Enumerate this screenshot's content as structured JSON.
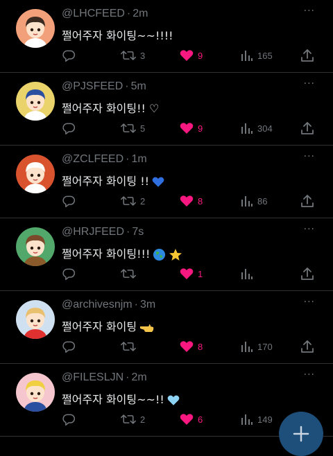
{
  "tweets": [
    {
      "handle": "@LHCFEED",
      "sep": "·",
      "time": "2m",
      "text": "쩔어주자 화이팅~~!!!!",
      "emoji": "",
      "retweets": "3",
      "likes": "9",
      "views": "165"
    },
    {
      "handle": "@PJSFEED",
      "sep": "·",
      "time": "5m",
      "text": "쩔어주자 화이팅!! ♡",
      "emoji": "",
      "retweets": "5",
      "likes": "9",
      "views": "304"
    },
    {
      "handle": "@ZCLFEED",
      "sep": "·",
      "time": "1m",
      "text": "쩔어주자 화이팅 !!",
      "emoji": "blue-heart",
      "retweets": "2",
      "likes": "8",
      "views": "86"
    },
    {
      "handle": "@HRJFEED",
      "sep": "·",
      "time": "7s",
      "text": "쩔어주자 화이팅!!!",
      "emoji": "globe-star",
      "retweets": "",
      "likes": "1",
      "views": ""
    },
    {
      "handle": "@archivesnjm",
      "sep": "·",
      "time": "3m",
      "text": "쩔어주자 화이팅",
      "emoji": "pointing-hand",
      "retweets": "",
      "likes": "8",
      "views": "170"
    },
    {
      "handle": "@FILESLJN",
      "sep": "·",
      "time": "2m",
      "text": "쩔어주자 화이팅~~!!",
      "emoji": "light-blue-heart",
      "retweets": "2",
      "likes": "6",
      "views": "149"
    }
  ],
  "more_label": "···",
  "colors": {
    "background": "#000000",
    "text": "#e7e9ea",
    "muted": "#71767b",
    "like": "#f91880",
    "divider": "#2f3336",
    "fab": "#1d4f7a"
  },
  "avatars": [
    {
      "bg": "#f2a07a",
      "hair": "#3a2a20",
      "shirt": "#ffffff"
    },
    {
      "bg": "#e9d36a",
      "hair": "#2a4fa0",
      "shirt": "#ffffff"
    },
    {
      "bg": "#d9542e",
      "hair": "#ffffff",
      "shirt": "#ffffff"
    },
    {
      "bg": "#52a86a",
      "hair": "#7a4a2a",
      "shirt": "#8a5a2a"
    },
    {
      "bg": "#cfe0f0",
      "hair": "#e8c070",
      "shirt": "#e03030"
    },
    {
      "bg": "#f6c6cf",
      "hair": "#f0d040",
      "shirt": "#2a4fa0"
    }
  ]
}
